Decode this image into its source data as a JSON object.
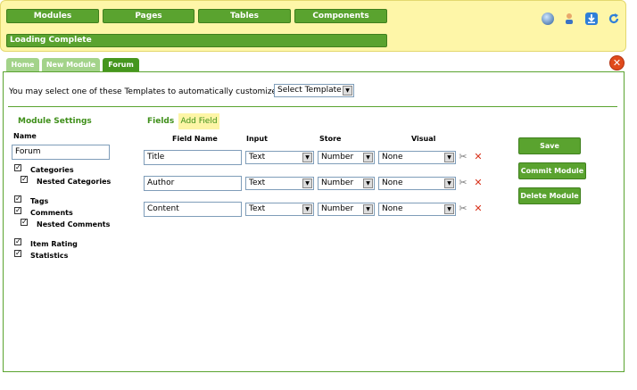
{
  "nav": {
    "modules": "Modules",
    "pages": "Pages",
    "tables": "Tables",
    "components": "Components"
  },
  "status": "Loading Complete",
  "toolbar_icons": [
    "globe-icon",
    "users-icon",
    "download-icon",
    "refresh-icon"
  ],
  "tabs": [
    {
      "label": "Home",
      "active": false
    },
    {
      "label": "New Module",
      "active": false
    },
    {
      "label": "Forum",
      "active": true
    }
  ],
  "template": {
    "text": "You may select one of these Templates to automatically customize settings.",
    "select_value": "Select Template"
  },
  "module_settings": {
    "heading": "Module Settings",
    "name_label": "Name",
    "name_value": "Forum",
    "options": [
      {
        "label": "Categories",
        "checked": true
      },
      {
        "label": "Nested Categories",
        "checked": true
      },
      {
        "label": "Tags",
        "checked": true
      },
      {
        "label": "Comments",
        "checked": true
      },
      {
        "label": "Nested Comments",
        "checked": true
      },
      {
        "label": "Item Rating",
        "checked": true
      },
      {
        "label": "Statistics",
        "checked": true
      }
    ]
  },
  "fields": {
    "heading": "Fields",
    "add_label": "Add Field",
    "columns": [
      "Field Name",
      "Input",
      "Store",
      "Visual"
    ],
    "rows": [
      {
        "name": "Title",
        "input": "Text",
        "store": "Number",
        "visual": "None"
      },
      {
        "name": "Author",
        "input": "Text",
        "store": "Number",
        "visual": "None"
      },
      {
        "name": "Content",
        "input": "Text",
        "store": "Number",
        "visual": "None"
      }
    ]
  },
  "actions": {
    "save": "Save",
    "commit": "Commit Module",
    "delete": "Delete Module"
  },
  "colors": {
    "accent_green": "#5aa32f",
    "header_yellow": "#fef6a8",
    "close_red": "#e04b1c"
  }
}
